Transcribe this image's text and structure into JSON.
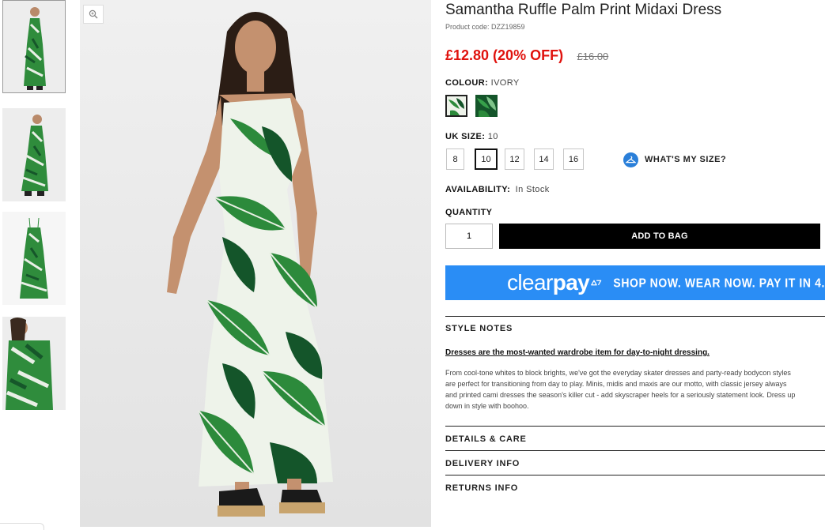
{
  "product": {
    "title": "Samantha Ruffle Palm Print Midaxi Dress",
    "code": "Product code: DZZ19859"
  },
  "price": {
    "current": "£12.80 (20% OFF)",
    "original": "£16.00",
    "sale_color": "#e0120d"
  },
  "colour": {
    "label": "COLOUR:",
    "value": "IVORY",
    "swatches": [
      {
        "name": "Ivory",
        "selected": true
      },
      {
        "name": "Green",
        "selected": false
      }
    ]
  },
  "size": {
    "label": "UK SIZE:",
    "value": "10",
    "options": [
      "8",
      "10",
      "12",
      "14",
      "16"
    ],
    "selected": "10",
    "guide_label": "WHAT'S MY SIZE?",
    "guide_icon": "hanger-icon"
  },
  "availability": {
    "label": "AVAILABILITY:",
    "value": "In Stock"
  },
  "quantity": {
    "label": "QUANTITY",
    "value": "1"
  },
  "cart": {
    "add_label": "ADD TO BAG"
  },
  "clearpay": {
    "word_light": "clear",
    "word_bold": "pay",
    "tagline": "SHOP NOW. WEAR NOW. PAY IT IN 4.",
    "color": "#2a8df5"
  },
  "style_notes": {
    "heading": "STYLE NOTES",
    "subheading": "Dresses are the most-wanted wardrobe item for day-to-night dressing.",
    "lines": [
      "From cool-tone whites to block brights, we've got the everyday skater dresses and party-ready bodycon styles",
      "are perfect for transitioning from day to play. Minis, midis and maxis are our motto, with classic jersey always",
      "and printed cami dresses the season's killer cut - add skyscraper heels for a seriously statement look. Dress up",
      "down in style with boohoo."
    ]
  },
  "accordions": {
    "details": "DETAILS & CARE",
    "delivery": "DELIVERY INFO",
    "returns": "RETURNS INFO"
  },
  "gallery": {
    "zoom_icon": "zoom-icon",
    "thumbnail_count": 4
  }
}
